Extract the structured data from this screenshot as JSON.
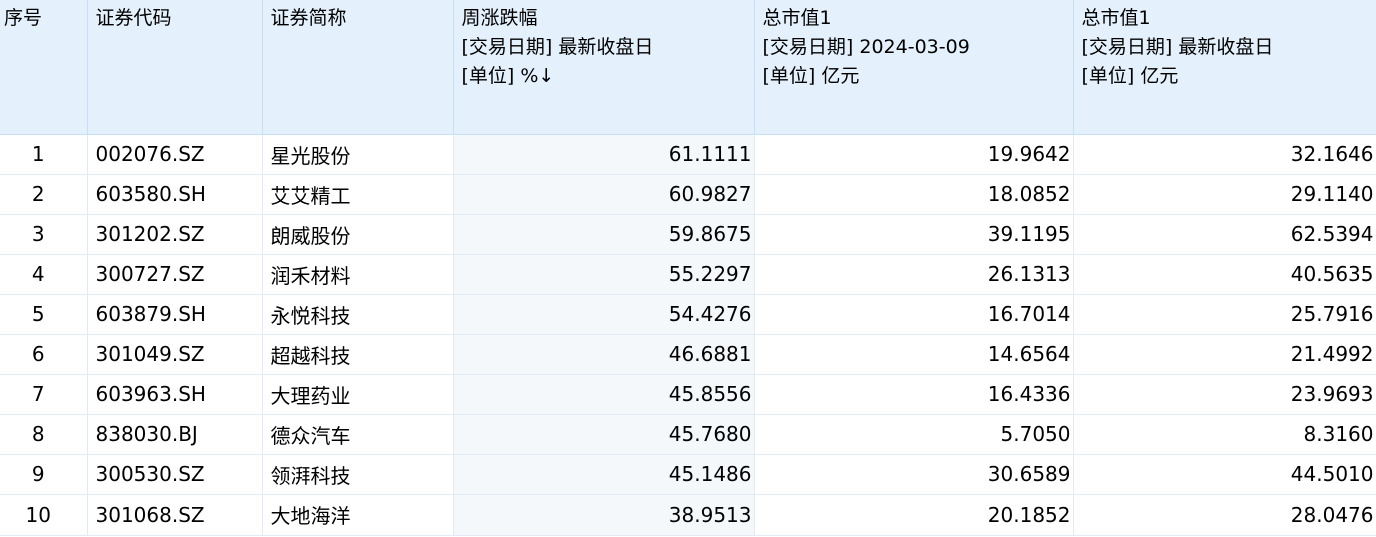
{
  "table": {
    "headers": {
      "index": "序号",
      "code": "证券代码",
      "name": "证券简称",
      "change": {
        "title": "周涨跌幅",
        "line2": "[交易日期] 最新收盘日",
        "line3": "[单位] %↓"
      },
      "mktcap_date": {
        "title": "总市值1",
        "line2": "[交易日期] 2024-03-09",
        "line3": "[单位] 亿元"
      },
      "mktcap_latest": {
        "title": "总市值1",
        "line2": "[交易日期] 最新收盘日",
        "line3": "[单位] 亿元"
      }
    },
    "rows": [
      {
        "idx": "1",
        "code": "002076.SZ",
        "name": "星光股份",
        "chg": "61.1111",
        "mv1": "19.9642",
        "mv2": "32.1646"
      },
      {
        "idx": "2",
        "code": "603580.SH",
        "name": "艾艾精工",
        "chg": "60.9827",
        "mv1": "18.0852",
        "mv2": "29.1140"
      },
      {
        "idx": "3",
        "code": "301202.SZ",
        "name": "朗威股份",
        "chg": "59.8675",
        "mv1": "39.1195",
        "mv2": "62.5394"
      },
      {
        "idx": "4",
        "code": "300727.SZ",
        "name": "润禾材料",
        "chg": "55.2297",
        "mv1": "26.1313",
        "mv2": "40.5635"
      },
      {
        "idx": "5",
        "code": "603879.SH",
        "name": "永悦科技",
        "chg": "54.4276",
        "mv1": "16.7014",
        "mv2": "25.7916"
      },
      {
        "idx": "6",
        "code": "301049.SZ",
        "name": "超越科技",
        "chg": "46.6881",
        "mv1": "14.6564",
        "mv2": "21.4992"
      },
      {
        "idx": "7",
        "code": "603963.SH",
        "name": "大理药业",
        "chg": "45.8556",
        "mv1": "16.4336",
        "mv2": "23.9693"
      },
      {
        "idx": "8",
        "code": "838030.BJ",
        "name": "德众汽车",
        "chg": "45.7680",
        "mv1": "5.7050",
        "mv2": "8.3160"
      },
      {
        "idx": "9",
        "code": "300530.SZ",
        "name": "领湃科技",
        "chg": "45.1486",
        "mv1": "30.6589",
        "mv2": "44.5010"
      },
      {
        "idx": "10",
        "code": "301068.SZ",
        "name": "大地海洋",
        "chg": "38.9513",
        "mv1": "20.1852",
        "mv2": "28.0476"
      }
    ]
  },
  "colors": {
    "header_bg": "#e4f0fc",
    "grid_line": "#e2ebf4",
    "sorted_column_bg": "#f5f8fb"
  }
}
